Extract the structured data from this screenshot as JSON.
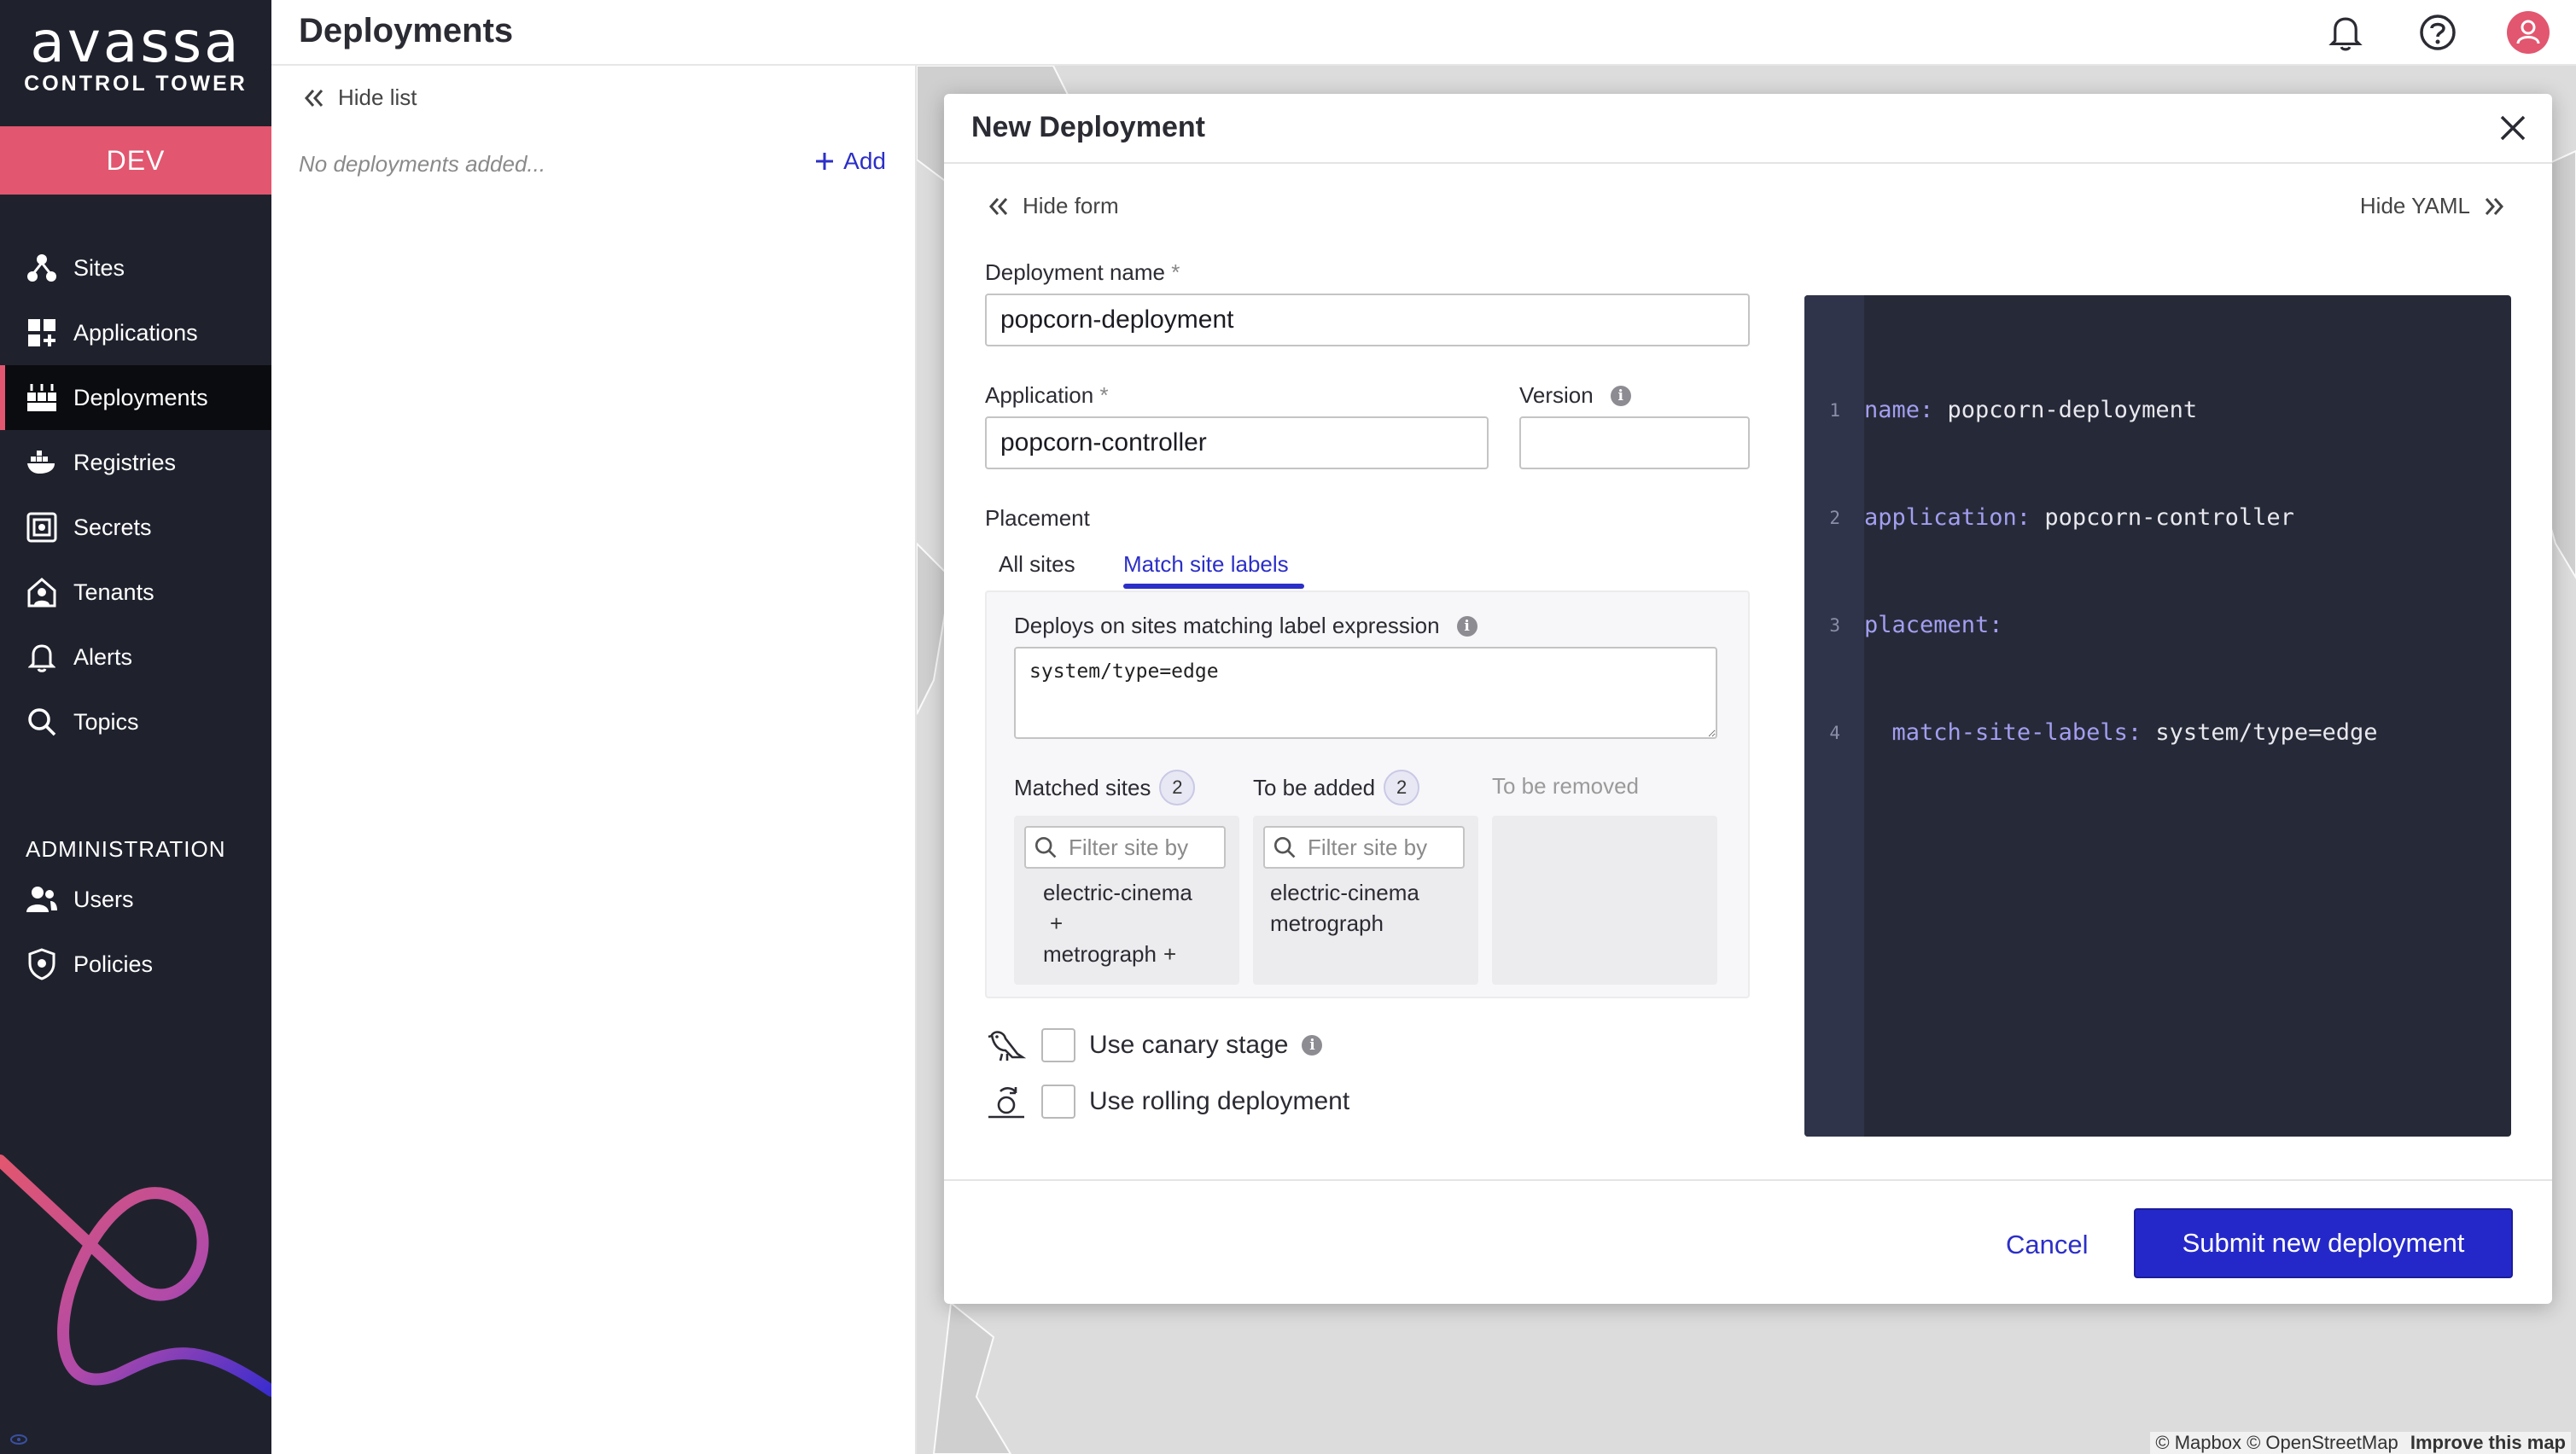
{
  "brand": {
    "name": "avassa",
    "subtitle": "CONTROL TOWER",
    "accent": "#e2566f",
    "primary": "#2528c9"
  },
  "environment": "DEV",
  "sidebar": {
    "items": [
      {
        "label": "Sites",
        "icon": "sites-icon"
      },
      {
        "label": "Applications",
        "icon": "applications-icon"
      },
      {
        "label": "Deployments",
        "icon": "deployments-icon",
        "active": true
      },
      {
        "label": "Registries",
        "icon": "registries-icon"
      },
      {
        "label": "Secrets",
        "icon": "secrets-icon"
      },
      {
        "label": "Tenants",
        "icon": "tenants-icon"
      },
      {
        "label": "Alerts",
        "icon": "bell-icon"
      },
      {
        "label": "Topics",
        "icon": "search-icon"
      }
    ],
    "admin_title": "ADMINISTRATION",
    "admin_items": [
      {
        "label": "Users",
        "icon": "users-icon"
      },
      {
        "label": "Policies",
        "icon": "shield-icon"
      }
    ]
  },
  "header": {
    "title": "Deployments",
    "icons": [
      "bell-icon",
      "help-icon",
      "user-avatar-icon"
    ]
  },
  "list_pane": {
    "hide_label": "Hide list",
    "empty_message": "No deployments added...",
    "add_label": "Add"
  },
  "modal": {
    "title": "New Deployment",
    "hide_form": "Hide form",
    "hide_yaml": "Hide YAML",
    "fields": {
      "deployment_name": {
        "label": "Deployment name",
        "required": "*",
        "value": "popcorn-deployment"
      },
      "application": {
        "label": "Application",
        "required": "*",
        "value": "popcorn-controller"
      },
      "version": {
        "label": "Version",
        "value": ""
      }
    },
    "placement": {
      "label": "Placement",
      "tabs": [
        {
          "label": "All sites"
        },
        {
          "label": "Match site labels",
          "active": true
        }
      ],
      "expression_label": "Deploys on sites matching label expression",
      "expression": "system/type=edge",
      "matched": {
        "title": "Matched sites",
        "count": "2",
        "filter_placeholder": "Filter site by",
        "sites": [
          "electric-cinema",
          "metrograph"
        ]
      },
      "to_add": {
        "title": "To be added",
        "count": "2",
        "filter_placeholder": "Filter site by",
        "sites": [
          "electric-cinema",
          "metrograph"
        ]
      },
      "to_remove": {
        "title": "To be removed"
      }
    },
    "options": {
      "canary": {
        "label": "Use canary stage",
        "checked": false
      },
      "rolling": {
        "label": "Use rolling deployment",
        "checked": false
      }
    },
    "yaml": [
      {
        "num": "1",
        "indent": "",
        "key": "name:",
        "value": " popcorn-deployment"
      },
      {
        "num": "2",
        "indent": "",
        "key": "application:",
        "value": " popcorn-controller"
      },
      {
        "num": "3",
        "indent": "",
        "key": "placement:",
        "value": ""
      },
      {
        "num": "4",
        "indent": "  ",
        "key": "match-site-labels:",
        "value": " system/type=edge"
      }
    ],
    "cancel_label": "Cancel",
    "submit_label": "Submit new deployment"
  },
  "map": {
    "attribution": "© Mapbox © OpenStreetMap",
    "improve": "Improve this map"
  }
}
